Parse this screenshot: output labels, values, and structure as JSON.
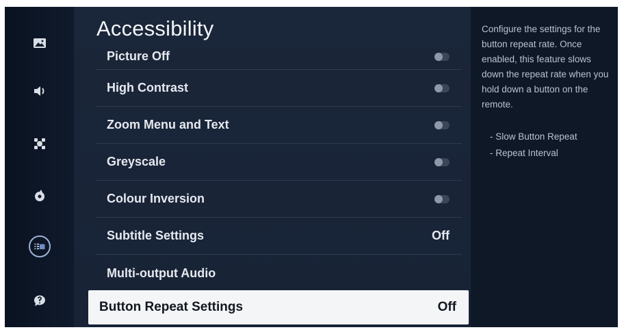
{
  "menu": {
    "title": "Accessibility",
    "items": [
      {
        "label": "Picture Off",
        "type": "toggle"
      },
      {
        "label": "High Contrast",
        "type": "toggle"
      },
      {
        "label": "Zoom Menu and Text",
        "type": "toggle"
      },
      {
        "label": "Greyscale",
        "type": "toggle"
      },
      {
        "label": "Colour Inversion",
        "type": "toggle"
      },
      {
        "label": "Subtitle Settings",
        "type": "value",
        "value": "Off"
      },
      {
        "label": "Multi-output Audio",
        "type": "none"
      }
    ],
    "selected": {
      "label": "Button Repeat Settings",
      "value": "Off"
    }
  },
  "sidebar": {
    "icons": [
      "picture-icon",
      "sound-icon",
      "connection-icon",
      "general-icon",
      "accessibility-icon",
      "support-icon"
    ]
  },
  "description": {
    "text": "Configure the settings for the button repeat rate. Once enabled, this feature slows down the repeat rate when you hold down a button on the remote.",
    "bullets": [
      "- Slow Button Repeat",
      "- Repeat Interval"
    ]
  }
}
